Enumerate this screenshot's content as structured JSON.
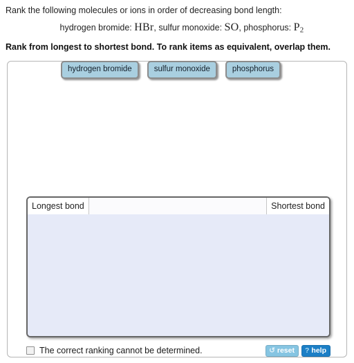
{
  "question": {
    "prompt": "Rank the following molecules or ions in order of decreasing bond length:",
    "species_line": {
      "item1_name": "hydrogen bromide:",
      "item1_formula": "HBr",
      "sep1": ", ",
      "item2_name": "sulfur monoxide:",
      "item2_formula": "SO",
      "sep2": ", ",
      "item3_name": "phosphorus:",
      "item3_formula_base": "P",
      "item3_formula_sub": "2"
    },
    "instruction": "Rank from longest to shortest bond. To rank items as equivalent, overlap them."
  },
  "tiles": [
    {
      "label": "hydrogen bromide"
    },
    {
      "label": "sulfur monoxide"
    },
    {
      "label": "phosphorus"
    }
  ],
  "rank_zone": {
    "left_label": "Longest bond",
    "right_label": "Shortest bond"
  },
  "bottom": {
    "checkbox_label": "The correct ranking cannot be determined.",
    "reset_label": "reset",
    "reset_icon": "↺",
    "help_label": "help",
    "help_icon": "?"
  },
  "colors": {
    "tile_fill": "#a9cfe0",
    "tile_border": "#8c8c8c",
    "zone_fill": "#e6eaf8",
    "zone_border": "#666666",
    "reset_bg": "#86c5e2",
    "help_bg": "#1c7fc6"
  }
}
